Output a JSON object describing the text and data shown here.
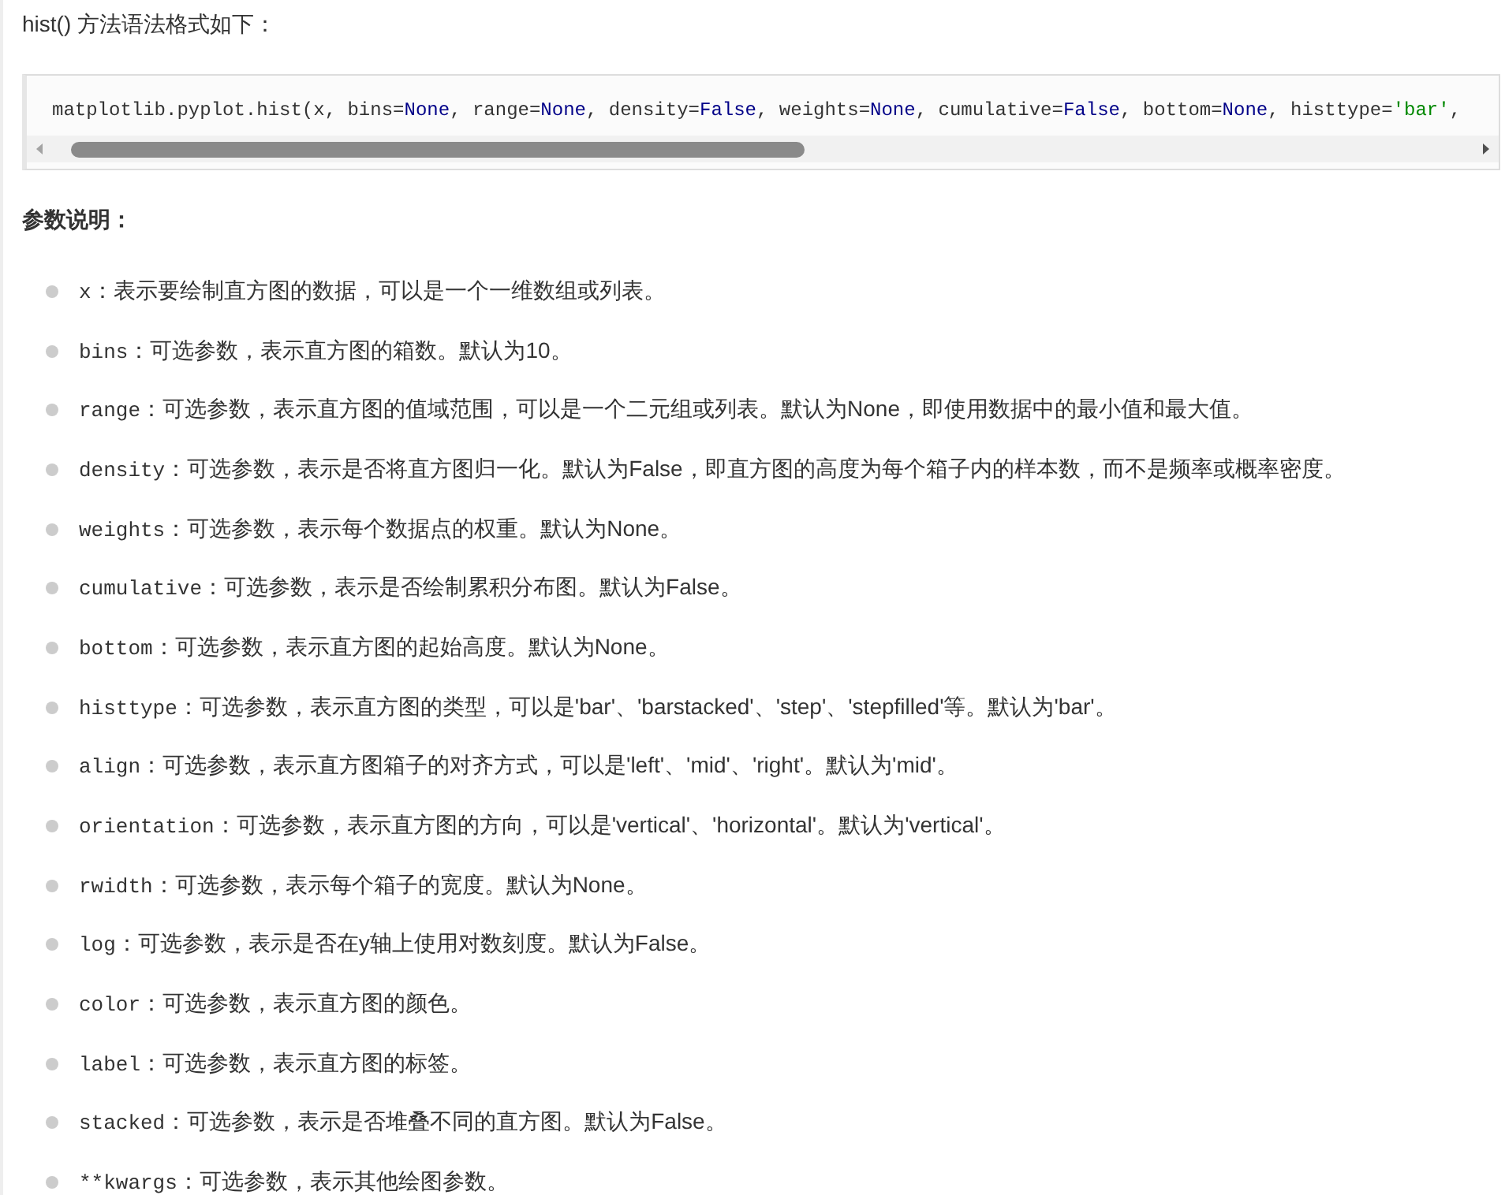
{
  "intro": "hist() 方法语法格式如下：",
  "code": [
    {
      "kind": "plain",
      "text": "matplotlib.pyplot.hist(x, bins="
    },
    {
      "kind": "keyword",
      "text": "None"
    },
    {
      "kind": "plain",
      "text": ", range="
    },
    {
      "kind": "keyword",
      "text": "None"
    },
    {
      "kind": "plain",
      "text": ", density="
    },
    {
      "kind": "keyword",
      "text": "False"
    },
    {
      "kind": "plain",
      "text": ", weights="
    },
    {
      "kind": "keyword",
      "text": "None"
    },
    {
      "kind": "plain",
      "text": ", cumulative="
    },
    {
      "kind": "keyword",
      "text": "False"
    },
    {
      "kind": "plain",
      "text": ", bottom="
    },
    {
      "kind": "keyword",
      "text": "None"
    },
    {
      "kind": "plain",
      "text": ", histtype="
    },
    {
      "kind": "string",
      "text": "'bar'"
    },
    {
      "kind": "plain",
      "text": ","
    }
  ],
  "heading": "参数说明：",
  "params": [
    {
      "name": "x",
      "desc": "：表示要绘制直方图的数据，可以是一个一维数组或列表。"
    },
    {
      "name": "bins",
      "desc": "：可选参数，表示直方图的箱数。默认为10。"
    },
    {
      "name": "range",
      "desc": "：可选参数，表示直方图的值域范围，可以是一个二元组或列表。默认为None，即使用数据中的最小值和最大值。"
    },
    {
      "name": "density",
      "desc": "：可选参数，表示是否将直方图归一化。默认为False，即直方图的高度为每个箱子内的样本数，而不是频率或概率密度。"
    },
    {
      "name": "weights",
      "desc": "：可选参数，表示每个数据点的权重。默认为None。"
    },
    {
      "name": "cumulative",
      "desc": "：可选参数，表示是否绘制累积分布图。默认为False。"
    },
    {
      "name": "bottom",
      "desc": "：可选参数，表示直方图的起始高度。默认为None。"
    },
    {
      "name": "histtype",
      "desc": "：可选参数，表示直方图的类型，可以是'bar'、'barstacked'、'step'、'stepfilled'等。默认为'bar'。"
    },
    {
      "name": "align",
      "desc": "：可选参数，表示直方图箱子的对齐方式，可以是'left'、'mid'、'right'。默认为'mid'。"
    },
    {
      "name": "orientation",
      "desc": "：可选参数，表示直方图的方向，可以是'vertical'、'horizontal'。默认为'vertical'。"
    },
    {
      "name": "rwidth",
      "desc": "：可选参数，表示每个箱子的宽度。默认为None。"
    },
    {
      "name": "log",
      "desc": "：可选参数，表示是否在y轴上使用对数刻度。默认为False。"
    },
    {
      "name": "color",
      "desc": "：可选参数，表示直方图的颜色。"
    },
    {
      "name": "label",
      "desc": "：可选参数，表示直方图的标签。"
    },
    {
      "name": "stacked",
      "desc": "：可选参数，表示是否堆叠不同的直方图。默认为False。"
    },
    {
      "name": "**kwargs",
      "desc": "：可选参数，表示其他绘图参数。"
    }
  ]
}
